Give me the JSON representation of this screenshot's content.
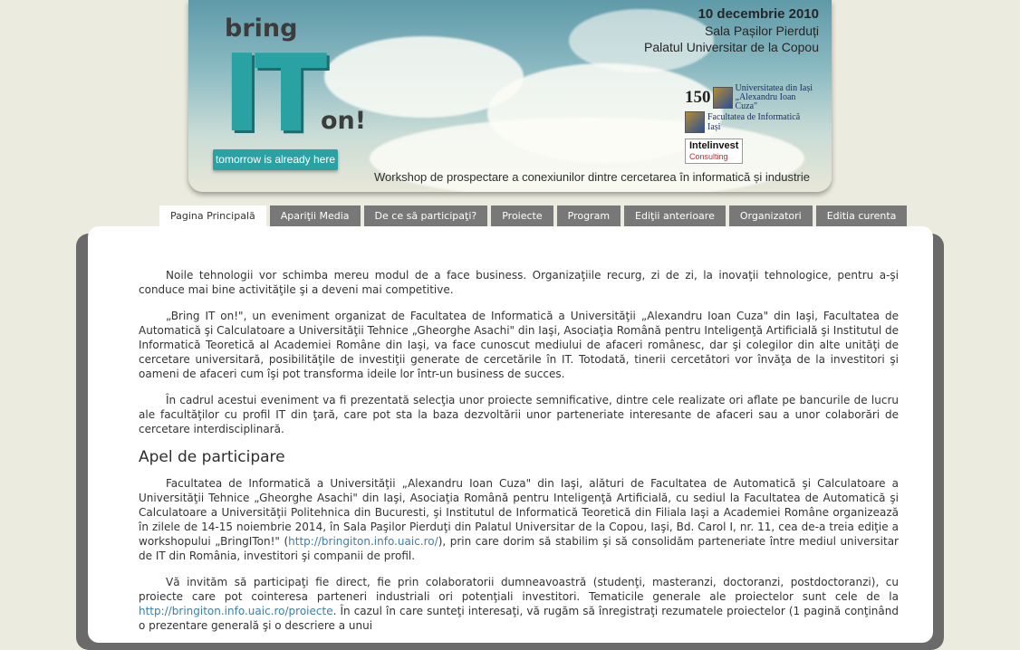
{
  "banner": {
    "logo": {
      "bring": "bring",
      "it": "IT",
      "on": "on!"
    },
    "tagline": "tomorrow is already here",
    "event": {
      "date": "10 decembrie 2010",
      "room": "Sala  Pașilor Pierduți",
      "place": "Palatul Universitar de la Copou"
    },
    "partners": {
      "uaic_number": "150",
      "uaic_name": "Universitatea din Iași „Alexandru Ioan Cuza\"",
      "fii_name": "Facultatea de Informatică Iași",
      "intelinvest_name": "Intelinvest",
      "intelinvest_sub": "Consulting"
    },
    "workshop": "Workshop de prospectare a conexiunilor dintre cercetarea în informatică și industrie"
  },
  "nav": {
    "tabs": [
      {
        "label": "Pagina Principală"
      },
      {
        "label": "Apariţii Media"
      },
      {
        "label": "De ce să participaţi?"
      },
      {
        "label": "Proiecte"
      },
      {
        "label": "Program"
      },
      {
        "label": "Ediţii anterioare"
      },
      {
        "label": "Organizatori"
      },
      {
        "label": "Editia curenta"
      }
    ]
  },
  "content": {
    "p1": "Noile tehnologii vor schimba mereu modul de a face business. Organizaţiile recurg, zi de zi, la inovaţii tehnologice, pentru a-şi conduce mai bine activităţile şi a deveni mai competitive.",
    "p2": "„Bring IT on!\", un eveniment organizat de Facultatea de Informatică a Universităţii „Alexandru Ioan Cuza\" din Iaşi, Facultatea de Automatică şi Calculatoare a Universităţii Tehnice „Gheorghe Asachi\" din Iaşi, Asociaţia Română pentru Inteligenţă Artificială şi Institutul de Informatică Teoretică al Academiei Române din Iaşi, va face cunoscut mediului de afaceri românesc, dar şi colegilor din alte unităţi de cercetare universitară, posibilităţile de investiţii generate de cercetările în IT. Totodată, tinerii cercetători vor învăţa de la investitori şi oameni de afaceri cum îşi pot transforma ideile lor într-un business de succes.",
    "p3": "În cadrul acestui eveniment va fi prezentată selecţia unor proiecte semnificative, dintre cele realizate ori aflate pe bancurile de lucru ale facultăţilor cu profil IT din ţară, care pot sta la baza dezvoltării unor parteneriate interesante de afaceri sau a unor colaborări de cercetare interdisciplinară.",
    "heading": "Apel de participare",
    "p4_a": "Facultatea de Informatică a Universităţii „Alexandru Ioan Cuza\" din Iaşi, alături de Facultatea de Automatică şi Calculatoare a Universităţii Tehnice „Gheorghe Asachi\" din Iaşi, Asociaţia Română pentru Inteligenţă Artificială, cu sediul la Facultatea de Automatică şi Calculatoare a Universităţii Politehnica din Bucuresti, şi Institutul de Informatică Teoretică din Filiala Iaşi a Academiei Române organizează în zilele de 14-15 noiembrie 2014, în Sala Paşilor Pierduţi din Palatul Universitar de la Copou, Iaşi, Bd. Carol I, nr. 11, cea de-a treia ediţie a workshopului „BringITon!\" (",
    "p4_link": "http://bringiton.info.uaic.ro/",
    "p4_b": "), prin care dorim să stabilim şi să consolidăm parteneriate între mediul universitar de IT din România, investitori şi companii de profil.",
    "p5_a": "Vă invităm să participaţi fie direct, fie prin colaboratorii dumneavoastră (studenţi, masteranzi, doctoranzi, postdoctoranzi), cu proiecte care pot cointeresa parteneri industriali ori potenţiali investitori. Tematicile generale ale proiectelor sunt cele de la ",
    "p5_link": "http://bringiton.info.uaic.ro/proiecte",
    "p5_b": ". În cazul în care sunteţi interesaţi, vă rugăm să înregistraţi rezumatele proiectelor (1 pagină conţinând o prezentare generală şi o descriere a unui"
  }
}
